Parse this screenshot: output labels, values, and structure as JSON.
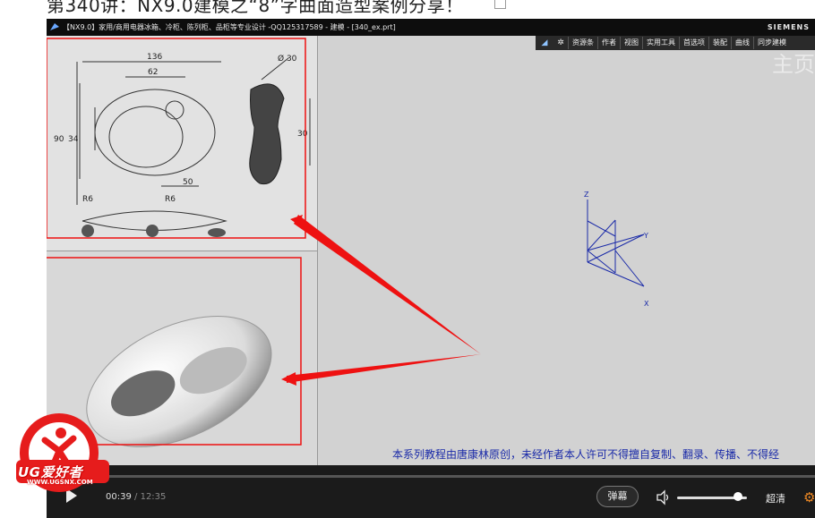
{
  "page": {
    "title": "第340讲：NX9.0建模之“8”字曲面造型案例分享！"
  },
  "nx": {
    "window_title": "【NX9.0】家用/商用电器冰箱、冷柜、陈列柜、品柜等专业设计 -QQ125317589 - 建模 - [340_ex.prt]",
    "brand": "SIEMENS",
    "toolbar_items": [
      "资源条",
      "作者",
      "视图",
      "实用工具",
      "首选项",
      "装配",
      "曲线",
      "同步建模"
    ],
    "ghost_text": "主页",
    "triad_labels": {
      "z": "Z",
      "y": "Y",
      "x": "X"
    }
  },
  "drawing": {
    "dims": {
      "width": "136",
      "inner": "62",
      "height": "90",
      "inner_h": "34",
      "bottom": "50",
      "phi": "Ø 30",
      "side": "30",
      "r1": "R6",
      "r2": "R6"
    }
  },
  "copyright": "本系列教程由唐康林原创，未经作者本人许可不得擅自复制、翻录、传播、不得经",
  "player": {
    "current_time": "00:39",
    "separator": "/",
    "duration": "12:35",
    "progress_fraction": 0.052,
    "danmaku_label": "弹幕",
    "quality_label": "超清",
    "volume_fraction": 0.87
  },
  "watermark": {
    "name": "UG爱好者",
    "url": "WWW.UGSNX.COM"
  },
  "colors": {
    "annotation_red": "#ee1111",
    "copyright_blue": "#1a2aa8",
    "settings_orange": "#f08a24"
  }
}
